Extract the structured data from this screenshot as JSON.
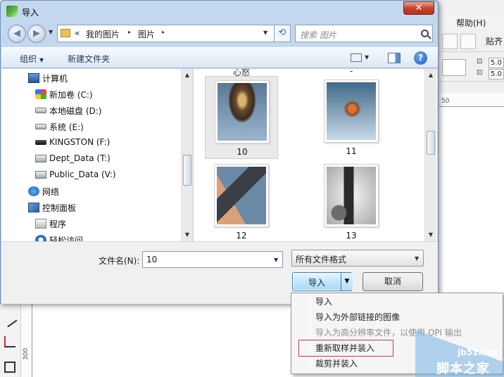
{
  "background_app": {
    "menu_help": "帮助(H)",
    "paste_label": "贴齐",
    "spin_value_1": "5.0",
    "spin_value_2": "5.0",
    "ruler_top_number": "50",
    "ruler_left_number": "300"
  },
  "dialog": {
    "title": "导入",
    "close_glyph": "✕",
    "address": {
      "prefix": "«",
      "segments": [
        "我的图片",
        "图片"
      ],
      "separator": "▸"
    },
    "search_placeholder": "搜索 图片",
    "toolbar": {
      "organize": "组织",
      "new_folder": "新建文件夹",
      "help_glyph": "?"
    },
    "nav_items": [
      {
        "label": "计算机",
        "icon": "computer-icon"
      },
      {
        "label": "新加卷 (C:)",
        "icon": "windows-drive-icon"
      },
      {
        "label": "本地磁盘 (D:)",
        "icon": "drive-icon"
      },
      {
        "label": "系统 (E:)",
        "icon": "drive-icon"
      },
      {
        "label": "KINGSTON (F:)",
        "icon": "usb-drive-icon"
      },
      {
        "label": "Dept_Data (T:)",
        "icon": "network-drive-icon"
      },
      {
        "label": "Public_Data (V:)",
        "icon": "network-drive-icon"
      },
      {
        "label": "网络",
        "icon": "network-icon"
      },
      {
        "label": "控制面板",
        "icon": "control-panel-icon"
      },
      {
        "label": "程序",
        "icon": "programs-icon"
      },
      {
        "label": "轻松访问",
        "icon": "ease-of-access-icon"
      }
    ],
    "files": [
      {
        "name": "10",
        "selected": true
      },
      {
        "name": "11",
        "selected": false
      },
      {
        "name": "12",
        "selected": false
      },
      {
        "name": "13",
        "selected": false
      }
    ],
    "partial_top_label": "心怒",
    "filename_label": "文件名(N):",
    "filename_value": "10",
    "filetype_value": "所有文件格式",
    "import_button": "导入",
    "cancel_button": "取消"
  },
  "import_menu": {
    "items": [
      {
        "label": "导入",
        "enabled": true
      },
      {
        "label": "导入为外部链接的图像",
        "enabled": true
      },
      {
        "label": "导入为高分辨率文件，以使用 OPI 输出",
        "enabled": false
      },
      {
        "label": "重新取样并装入",
        "enabled": true,
        "highlighted": true
      },
      {
        "label": "裁剪并装入",
        "enabled": true
      }
    ]
  },
  "watermark": {
    "url": "jb51.net",
    "name": "脚本之家"
  },
  "colors": {
    "dialog_frame": "#c3d8ee",
    "primary_button": "#bee6fd",
    "highlight_border": "#c43c3c"
  }
}
